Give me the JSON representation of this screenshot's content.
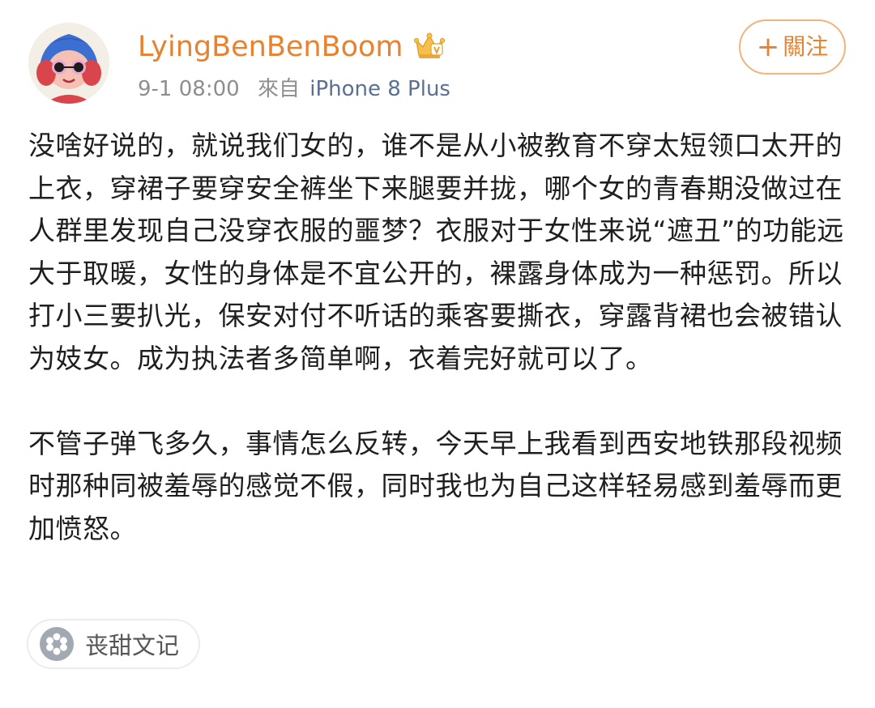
{
  "user": {
    "name": "LyingBenBenBoom",
    "avatar_icon": "user-avatar-illustration",
    "vip_icon": "crown-badge-icon"
  },
  "meta": {
    "time": "9-1 08:00",
    "source_label": "來自",
    "device": "iPhone 8 Plus"
  },
  "follow_button": {
    "plus": "+",
    "label": "關注"
  },
  "post": {
    "paragraphs": [
      "没啥好说的，就说我们女的，谁不是从小被教育不穿太短领口太开的上衣，穿裙子要穿安全裤坐下来腿要并拢，哪个女的青春期没做过在人群里发现自己没穿衣服的噩梦？衣服对于女性来说“遮丑”的功能远大于取暖，女性的身体是不宜公开的，裸露身体成为一种惩罚。所以打小三要扒光，保安对付不听话的乘客要撕衣，穿露背裙也会被错认为妓女。成为执法者多简单啊，衣着完好就可以了。",
      "不管子弹飞多久，事情怎么反转，今天早上我看到西安地铁那段视频时那种同被羞辱的感觉不假，同时我也为自己这样轻易感到羞辱而更加愤怒。"
    ]
  },
  "tag": {
    "icon": "flower-icon",
    "label": "丧甜文记"
  },
  "colors": {
    "username": "#e8822f",
    "device": "#5b6f91",
    "meta": "#8e8e8e",
    "follow_border": "#f0b37a"
  }
}
